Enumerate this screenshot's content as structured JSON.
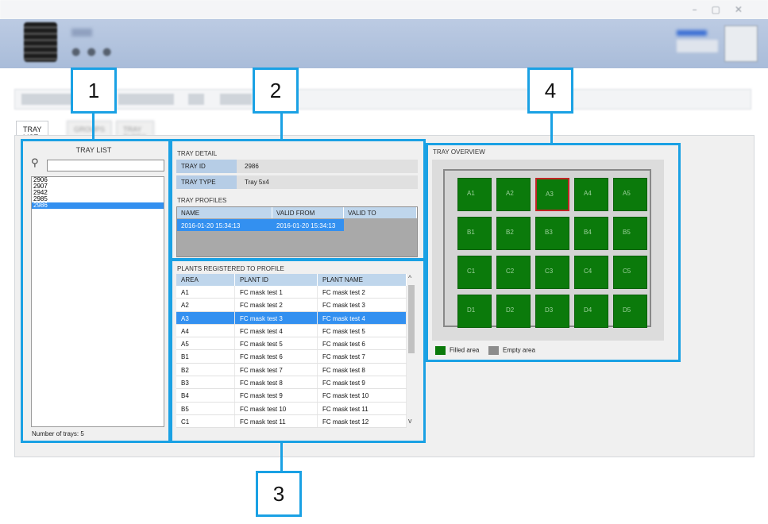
{
  "tabs": [
    "TRAY LIST",
    "GROUPS",
    "TRAY TYPES"
  ],
  "tray_list": {
    "title": "TRAY LIST",
    "items": [
      "2906",
      "2907",
      "2942",
      "2985",
      "2986"
    ],
    "selected": "2986",
    "count_label": "Number of trays: 5"
  },
  "tray_detail": {
    "title": "TRAY DETAIL",
    "tray_id_label": "TRAY ID",
    "tray_id": "2986",
    "tray_type_label": "TRAY TYPE",
    "tray_type": "Tray 5x4"
  },
  "tray_profiles": {
    "title": "TRAY PROFILES",
    "columns": [
      "NAME",
      "VALID FROM",
      "VALID TO"
    ],
    "rows": [
      {
        "name": "2016-01-20 15:34:13",
        "valid_from": "2016-01-20 15:34:13",
        "valid_to": ""
      }
    ]
  },
  "plants": {
    "title": "PLANTS REGISTERED TO PROFILE",
    "columns": [
      "AREA",
      "PLANT ID",
      "PLANT NAME"
    ],
    "rows": [
      [
        "A1",
        "FC mask test 1",
        "FC mask test 2"
      ],
      [
        "A2",
        "FC mask test 2",
        "FC mask test 3"
      ],
      [
        "A3",
        "FC mask test 3",
        "FC mask test 4"
      ],
      [
        "A4",
        "FC mask test 4",
        "FC mask test 5"
      ],
      [
        "A5",
        "FC mask test 5",
        "FC mask test 6"
      ],
      [
        "B1",
        "FC mask test 6",
        "FC mask test 7"
      ],
      [
        "B2",
        "FC mask test 7",
        "FC mask test 8"
      ],
      [
        "B3",
        "FC mask test 8",
        "FC mask test 9"
      ],
      [
        "B4",
        "FC mask test 9",
        "FC mask test 10"
      ],
      [
        "B5",
        "FC mask test 10",
        "FC mask test 11"
      ],
      [
        "C1",
        "FC mask test 11",
        "FC mask test 12"
      ]
    ],
    "selected_area": "A3"
  },
  "tray_overview": {
    "title": "TRAY OVERVIEW",
    "cells": [
      [
        "A1",
        "A2",
        "A3",
        "A4",
        "A5"
      ],
      [
        "B1",
        "B2",
        "B3",
        "B4",
        "B5"
      ],
      [
        "C1",
        "C2",
        "C3",
        "C4",
        "C5"
      ],
      [
        "D1",
        "D2",
        "D3",
        "D4",
        "D5"
      ]
    ],
    "highlighted": "A3",
    "legend": [
      {
        "label": "Filled area",
        "color": "#0b7a0b"
      },
      {
        "label": "Empty area",
        "color": "#8c8c8c"
      }
    ]
  },
  "callouts": [
    "1",
    "2",
    "3",
    "4"
  ],
  "colors": {
    "accent": "#1aa1e4",
    "selection": "#3390f0",
    "filled": "#0b7a0b"
  }
}
